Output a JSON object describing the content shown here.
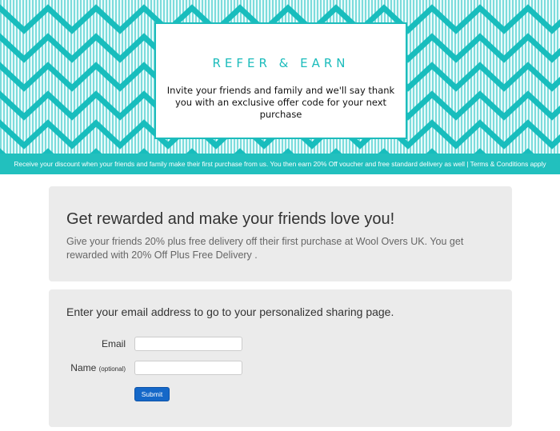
{
  "hero": {
    "title": "REFER & EARN",
    "text": "Invite your friends and family and we'll say thank you with an exclusive offer code for your next purchase"
  },
  "banner": {
    "text": "Receive your discount when your friends and family make their first purchase from us. You then earn 20% Off voucher and free standard delivery as well | Terms & Conditions apply"
  },
  "reward": {
    "heading": "Get rewarded and make your friends love you!",
    "description": "Give your friends 20% plus free delivery off their first purchase at Wool Overs UK. You get rewarded with 20% Off Plus Free Delivery ."
  },
  "form": {
    "intro": "Enter your email address to go to your personalized sharing page.",
    "email_label": "Email",
    "email_value": "",
    "name_label": "Name",
    "name_optional": "(optional)",
    "name_value": "",
    "submit_label": "Submit"
  },
  "colors": {
    "accent": "#1cbcbc",
    "banner": "#22c0be",
    "submit": "#1568c8",
    "panel": "#ebebeb"
  }
}
